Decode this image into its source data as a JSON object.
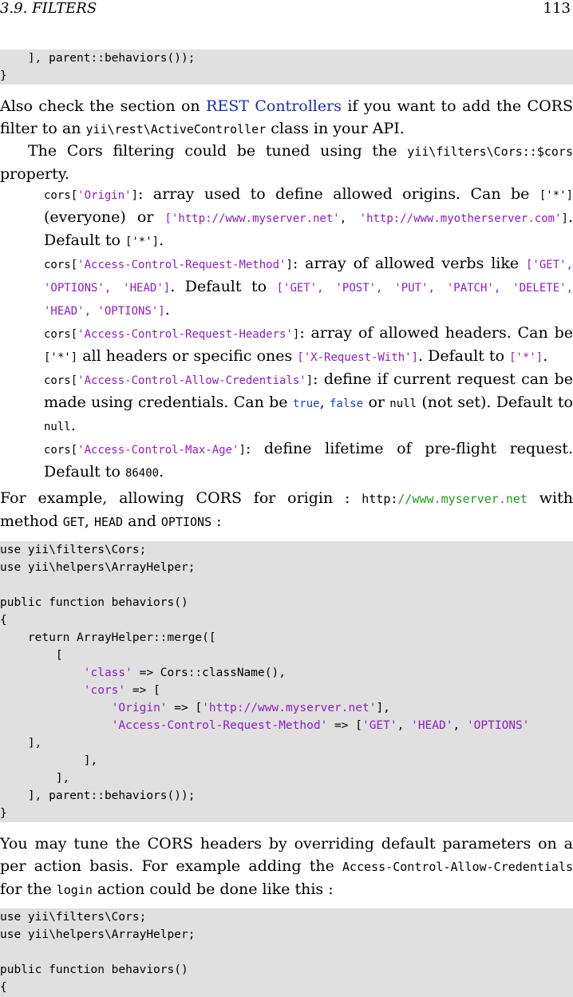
{
  "header": {
    "section": "3.9.   FILTERS",
    "page": "113"
  },
  "code1": {
    "lines": [
      [
        {
          "t": "    ], parent::behaviors());"
        }
      ],
      [
        {
          "t": "}"
        }
      ]
    ]
  },
  "p1": {
    "a": "Also check the section on ",
    "link": "REST Controllers",
    "b": " if you want to add the CORS filter to an ",
    "code": "yii\\rest\\ActiveController",
    "c": " class in your API."
  },
  "p2": {
    "a": "The Cors filtering could be tuned using the ",
    "code": "yii\\filters\\Cors::$cors",
    "b": " property."
  },
  "list": {
    "origin": {
      "k": "cors[",
      "key": "'Origin'",
      "k2": "]",
      "t1": ": array used to define allowed origins. Can be ",
      "v1": "['*'",
      "v1b": "]",
      "t2": " (everyone) or ",
      "v2a": "['http://www.myserver.net'",
      "v2sep": ", ",
      "v2b": "'http://www.myotherserver.com'",
      "v2c": "]",
      "t3": ". Default to ",
      "v3": "['*']",
      "t4": "."
    },
    "method": {
      "k": "cors[",
      "key": "'Access-Control-Request-Method'",
      "k2": "]",
      "t1": ": array of allowed verbs like ",
      "v1": "['GET', 'OPTIONS', 'HEAD']",
      "t2": ". Default to ",
      "v2": "['GET', 'POST', 'PUT', 'PATCH', 'DELETE', 'HEAD', 'OPTIONS']",
      "t3": "."
    },
    "headers": {
      "k": "cors[",
      "key": "'Access-Control-Request-Headers'",
      "k2": "]",
      "t1": ": array of allowed headers. Can be ",
      "v1": "['*']",
      "t2": " all headers or specific ones ",
      "v2": "['X-Request-With']",
      "t3": ". Default to ",
      "v3": "['*']",
      "t4": "."
    },
    "credentials": {
      "k": "cors[",
      "key": "'Access-Control-Allow-Credentials'",
      "k2": "]",
      "t1": ": define if current request can be made using credentials. Can be ",
      "v1": "true",
      "t2": ", ",
      "v2": "false",
      "t3": " or ",
      "v3": "null",
      "t4": " (not set). Default to ",
      "v4": "null",
      "t5": "."
    },
    "maxage": {
      "k": "cors[",
      "key": "'Access-Control-Max-Age'",
      "k2": "]",
      "t1": ": define lifetime of pre-flight request. Default to ",
      "v1": "86400",
      "t2": "."
    }
  },
  "p3": {
    "a": "For example, allowing CORS for origin : ",
    "c1": "http:",
    "c2": "//www.myserver.net",
    "b": " with method ",
    "m1": "GET",
    "s1": ", ",
    "m2": "HEAD",
    "s2": " and ",
    "m3": "OPTIONS",
    "s3": " :"
  },
  "code2": {
    "lines": [
      [
        {
          "t": "use yii\\filters\\Cors;"
        }
      ],
      [
        {
          "t": "use yii\\helpers\\ArrayHelper;"
        }
      ],
      [
        {
          "t": ""
        }
      ],
      [
        {
          "t": "public function behaviors()"
        }
      ],
      [
        {
          "t": "{"
        }
      ],
      [
        {
          "t": "    return ArrayHelper::merge(["
        }
      ],
      [
        {
          "t": "        ["
        }
      ],
      [
        {
          "t": "            "
        },
        {
          "t": "'class'",
          "c": "str"
        },
        {
          "t": " => Cors::className(),"
        }
      ],
      [
        {
          "t": "            "
        },
        {
          "t": "'cors'",
          "c": "str"
        },
        {
          "t": " => ["
        }
      ],
      [
        {
          "t": "                "
        },
        {
          "t": "'Origin'",
          "c": "str"
        },
        {
          "t": " => ["
        },
        {
          "t": "'http://www.myserver.net'",
          "c": "str"
        },
        {
          "t": "],"
        }
      ],
      [
        {
          "t": "                "
        },
        {
          "t": "'Access-Control-Request-Method'",
          "c": "str"
        },
        {
          "t": " => ["
        },
        {
          "t": "'GET'",
          "c": "str"
        },
        {
          "t": ", "
        },
        {
          "t": "'HEAD'",
          "c": "str"
        },
        {
          "t": ", "
        },
        {
          "t": "'OPTIONS'",
          "c": "str"
        }
      ],
      [
        {
          "t": "    ],"
        }
      ],
      [
        {
          "t": "            ],"
        }
      ],
      [
        {
          "t": "        ],"
        }
      ],
      [
        {
          "t": "    ], parent::behaviors());"
        }
      ],
      [
        {
          "t": "}"
        }
      ]
    ]
  },
  "p4": {
    "a": "You may tune the CORS headers by overriding default parameters on a per action basis. For example adding the ",
    "code1": "Access-Control-Allow-Credentials",
    "b": " for the ",
    "code2": "login",
    "c": " action could be done like this :"
  },
  "code3": {
    "lines": [
      [
        {
          "t": "use yii\\filters\\Cors;"
        }
      ],
      [
        {
          "t": "use yii\\helpers\\ArrayHelper;"
        }
      ],
      [
        {
          "t": ""
        }
      ],
      [
        {
          "t": "public function behaviors()"
        }
      ],
      [
        {
          "t": "{"
        }
      ]
    ]
  }
}
